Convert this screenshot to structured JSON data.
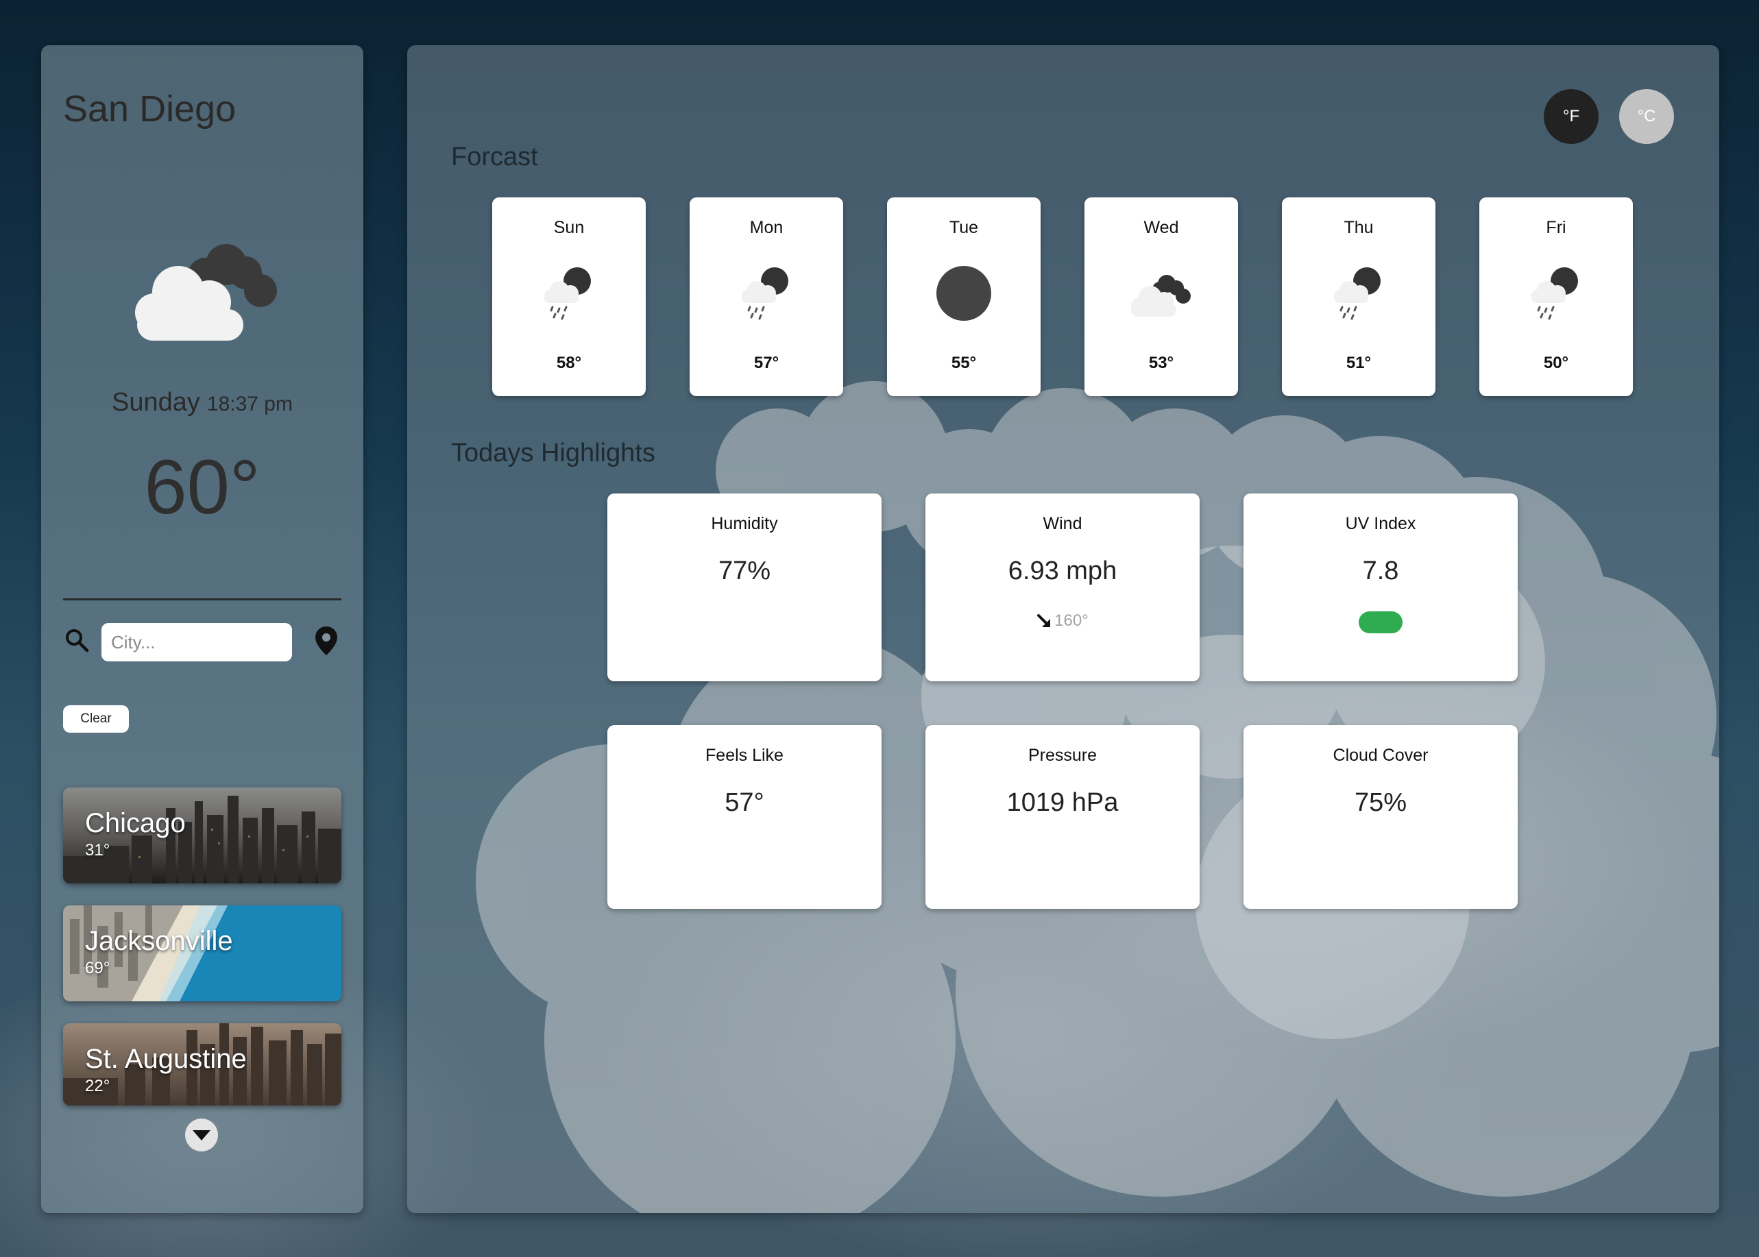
{
  "sidebar": {
    "city": "San Diego",
    "day": "Sunday",
    "time": "18:37 pm",
    "temperature": "60°",
    "icon": "cloudy-night-icon",
    "search_placeholder": "City...",
    "clear_label": "Clear",
    "saved_cities": [
      {
        "name": "Chicago",
        "temp": "31°"
      },
      {
        "name": "Jacksonville",
        "temp": "69°"
      },
      {
        "name": "St. Augustine",
        "temp": "22°"
      }
    ]
  },
  "units": {
    "fahrenheit": "°F",
    "celsius": "°C",
    "active": "fahrenheit"
  },
  "forecast": {
    "title": "Forcast",
    "days": [
      {
        "day": "Sun",
        "temp": "58°",
        "icon": "rain-night-icon"
      },
      {
        "day": "Mon",
        "temp": "57°",
        "icon": "rain-night-icon"
      },
      {
        "day": "Tue",
        "temp": "55°",
        "icon": "moon-icon"
      },
      {
        "day": "Wed",
        "temp": "53°",
        "icon": "cloudy-night-icon"
      },
      {
        "day": "Thu",
        "temp": "51°",
        "icon": "rain-night-icon"
      },
      {
        "day": "Fri",
        "temp": "50°",
        "icon": "rain-night-icon"
      }
    ]
  },
  "highlights": {
    "title": "Todays Highlights",
    "humidity": {
      "label": "Humidity",
      "value": "77%"
    },
    "wind": {
      "label": "Wind",
      "value": "6.93 mph",
      "direction": "160°"
    },
    "uv": {
      "label": "UV Index",
      "value": "7.8",
      "color": "#2fac50"
    },
    "feels_like": {
      "label": "Feels Like",
      "value": "57°"
    },
    "pressure": {
      "label": "Pressure",
      "value": "1019 hPa"
    },
    "cloud_cover": {
      "label": "Cloud Cover",
      "value": "75%"
    }
  },
  "colors": {
    "active_unit": "#222222",
    "inactive_unit": "#c2c2c2",
    "uv_moderate": "#2fac50"
  }
}
